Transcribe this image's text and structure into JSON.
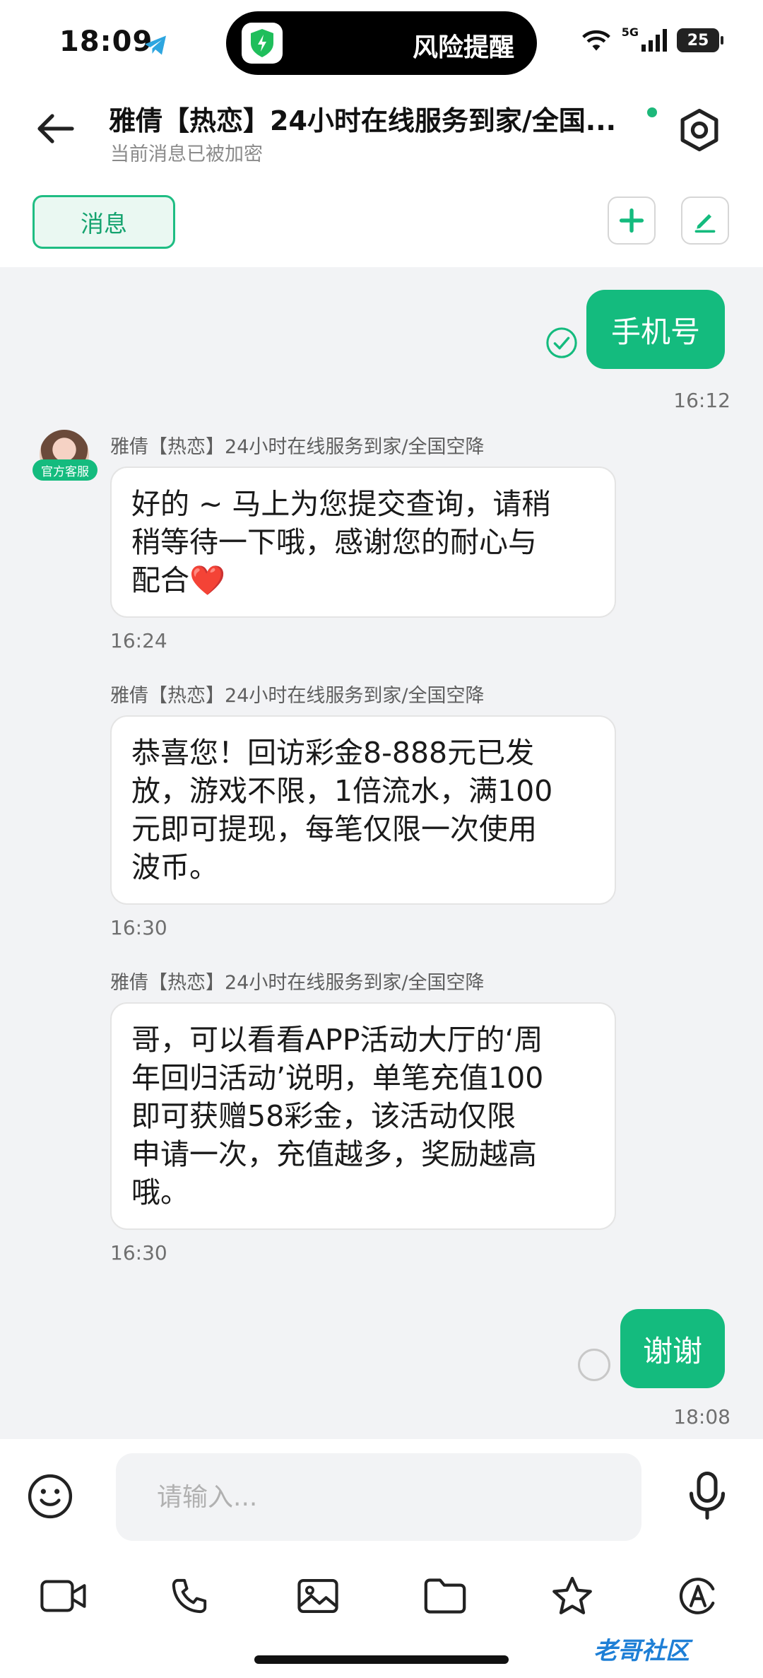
{
  "status_bar": {
    "time": "18:09",
    "island_text": "风险提醒",
    "network": "5G",
    "battery": "25"
  },
  "header": {
    "title": "雅倩【热恋】24小时在线服务到家/全国...",
    "subtitle": "当前消息已被加密",
    "online_color": "#1db87a"
  },
  "toolbar": {
    "tab_label": "消息"
  },
  "messages": {
    "m1": {
      "text": "手机号",
      "time": "16:12"
    },
    "avatar_badge": "官方客服",
    "m2": {
      "sender": "雅倩【热恋】24小时在线服务到家/全国空降",
      "line1": "好的 ~ 马上为您提交查询，请稍",
      "line2": "稍等待一下哦，感谢您的耐心与",
      "line3": "配合",
      "emoji": "❤️",
      "time": "16:24"
    },
    "m3": {
      "sender": "雅倩【热恋】24小时在线服务到家/全国空降",
      "line1": "恭喜您！回访彩金8-888元已发",
      "line2": "放，游戏不限，1倍流水，满100",
      "line3": "元即可提现，每笔仅限一次使用",
      "line4": "波币。",
      "time": "16:30"
    },
    "m4": {
      "sender": "雅倩【热恋】24小时在线服务到家/全国空降",
      "line1": "哥，可以看看APP活动大厅的‘周",
      "line2": "年回归活动’说明，单笔充值100",
      "line3": "即可获赠58彩金，该活动仅限",
      "line4": "申请一次，充值越多，奖励越高",
      "line5": "哦。",
      "time": "16:30"
    },
    "m5": {
      "text": "谢谢",
      "time": "18:08"
    }
  },
  "input": {
    "placeholder": "请输入..."
  },
  "bottom_icons": [
    "video-icon",
    "phone-icon",
    "image-icon",
    "folder-icon",
    "star-icon",
    "translate-icon"
  ],
  "watermark": "老哥社区",
  "colors": {
    "accent": "#14bb7e",
    "chat_bg": "#f2f3f5"
  }
}
